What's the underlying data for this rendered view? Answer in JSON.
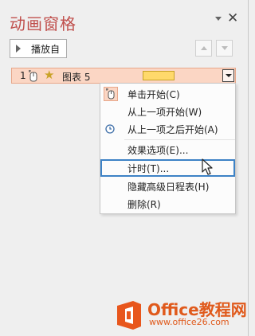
{
  "pane": {
    "title": "动画窗格",
    "close_glyph": "✕"
  },
  "toolbar": {
    "play_label": "播放自",
    "move_up_icon": "triangle-up-icon",
    "move_down_icon": "triangle-down-icon"
  },
  "animation_row": {
    "number": "1",
    "trigger_icon": "mouse-click-icon",
    "effect_icon": "star-icon",
    "label": "图表 5",
    "timeline_color": "#ffd96b"
  },
  "context_menu": {
    "items": [
      {
        "label": "单击开始(C)",
        "icon": "mouse-click-icon",
        "checked": true
      },
      {
        "label": "从上一项开始(W)",
        "icon": "",
        "checked": false
      },
      {
        "label": "从上一项之后开始(A)",
        "icon": "clock-icon",
        "checked": false
      },
      {
        "label": "效果选项(E)...",
        "icon": "",
        "checked": false
      },
      {
        "label": "计时(T)...",
        "icon": "",
        "checked": false,
        "highlighted": true
      },
      {
        "label": "隐藏高级日程表(H)",
        "icon": "",
        "checked": false
      },
      {
        "label": "删除(R)",
        "icon": "",
        "checked": false
      }
    ]
  },
  "watermark": {
    "title": "Office教程网",
    "url": "www.office26.com"
  },
  "colors": {
    "title": "#c0504d",
    "row_bg": "#fbd6c4",
    "highlight_border": "#3d82c6",
    "watermark": "#e05a1c"
  }
}
